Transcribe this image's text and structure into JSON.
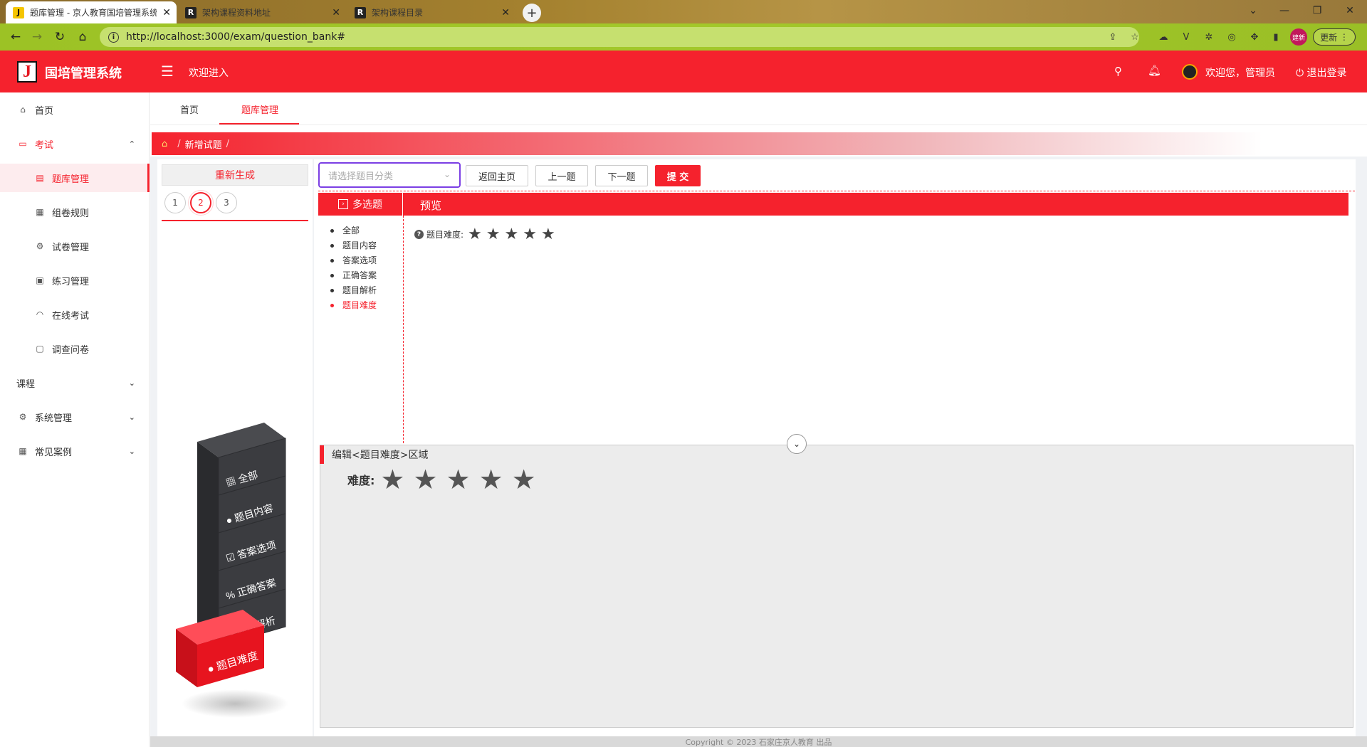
{
  "browser": {
    "tabs": [
      {
        "title": "题库管理 - 京人教育国培管理系统",
        "icon": "J"
      },
      {
        "title": "架构课程资料地址",
        "icon": "R"
      },
      {
        "title": "架构课程目录",
        "icon": "R"
      }
    ],
    "url": "http://localhost:3000/exam/question_bank#",
    "update_label": "更新",
    "profile_label": "建新"
  },
  "header": {
    "logo_letter": "J",
    "app_title": "国培管理系统",
    "welcome_enter": "欢迎进入",
    "user_greeting": "欢迎您，管理员",
    "logout": "退出登录"
  },
  "sidebar": {
    "home": "首页",
    "exam": "考试",
    "exam_items": [
      "题库管理",
      "组卷规则",
      "试卷管理",
      "练习管理",
      "在线考试",
      "调查问卷"
    ],
    "course": "课程",
    "system": "系统管理",
    "cases": "常见案例"
  },
  "page_tabs": [
    "首页",
    "题库管理"
  ],
  "breadcrumb": {
    "current": "新增试题",
    "sep": "/"
  },
  "left_panel": {
    "regenerate": "重新生成",
    "question_numbers": [
      "1",
      "2",
      "3"
    ],
    "current_index": 2
  },
  "tower": {
    "blocks": [
      "全部",
      "题目内容",
      "答案选项",
      "正确答案",
      "题目解析",
      "题目难度"
    ]
  },
  "toolbar": {
    "category_placeholder": "请选择题目分类",
    "back_home": "返回主页",
    "prev": "上一题",
    "next": "下一题",
    "submit": "提 交"
  },
  "editor": {
    "type_label": "多选题",
    "preview_label": "预览",
    "section_nav": [
      "全部",
      "题目内容",
      "答案选项",
      "正确答案",
      "题目解析",
      "题目难度"
    ],
    "active_section": "题目难度",
    "preview_difficulty_label": "题目难度:",
    "stars": "★★★★★",
    "edit_area_title": "编辑<题目难度>区域",
    "difficulty_label": "难度:"
  },
  "footer": {
    "copyright": "Copyright © 2023 石家庄京人教育 出品"
  },
  "colors": {
    "brand": "#f5222d",
    "select_border": "#7b3fe4"
  }
}
